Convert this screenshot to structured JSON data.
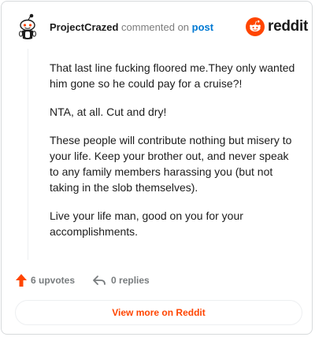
{
  "header": {
    "author": "ProjectCrazed",
    "action_text": "commented on",
    "post_link": "post",
    "brand": "reddit"
  },
  "comment": {
    "paragraphs": [
      "That last line fucking floored me.They only wanted him gone so he could pay for a cruise?!",
      "NTA, at all. Cut and dry!",
      "These people will contribute nothing but misery to your life. Keep your brother out, and never speak to any family members harassing you (but not taking in the slob themselves).",
      "Live your life man, good on you for your accomplishments."
    ]
  },
  "actions": {
    "upvotes": "6 upvotes",
    "replies": "0 replies"
  },
  "view_more": "View more on Reddit",
  "colors": {
    "accent": "#ff4500",
    "link": "#0079d3",
    "muted": "#787c7e"
  },
  "icons": [
    "snoo-avatar-icon",
    "reddit-logo-icon",
    "upvote-arrow-icon",
    "reply-arrow-icon"
  ]
}
